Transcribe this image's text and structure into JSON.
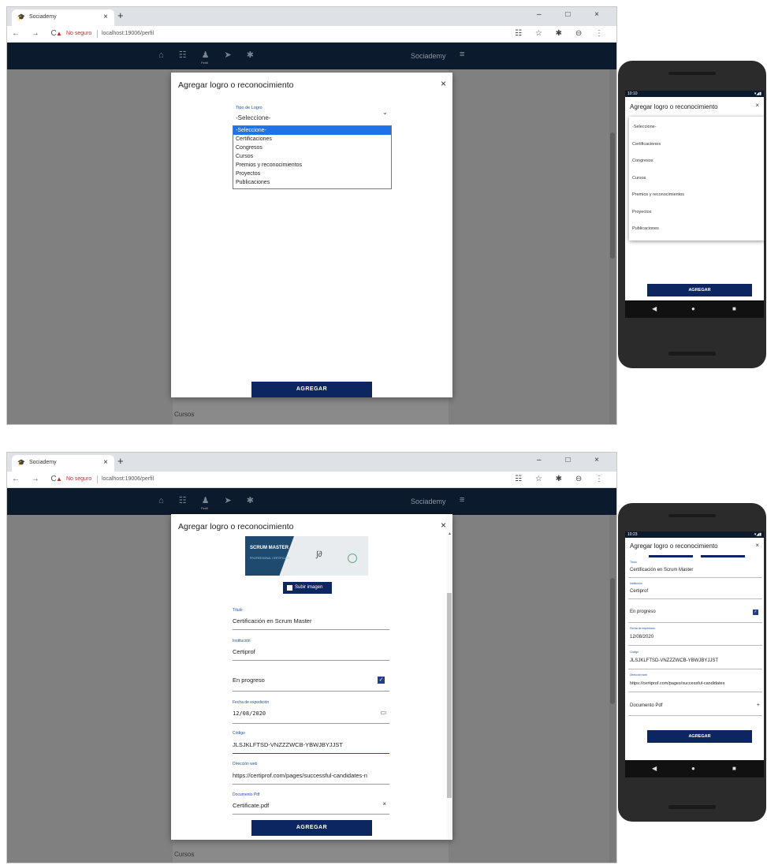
{
  "browser": {
    "tab_title": "Sociademy",
    "tab_close": "×",
    "new_tab": "+",
    "window_controls": "– □ ×",
    "nav_buttons": "← → C",
    "not_secure": "No seguro",
    "url": "localhost:19006/perfil",
    "extension_icons": "☷ ☆ ✱ ⊖ ⋮"
  },
  "app": {
    "brand": "Sociademy",
    "menu_icon": "≡",
    "nav_icons": "⌂ ☷ ♟ ➤ ✱",
    "nav_active_label": "Perfil",
    "background_section": "Cursos"
  },
  "modal": {
    "title": "Agregar logro o reconocimiento",
    "close": "×",
    "submit": "AGREGAR"
  },
  "top_panel": {
    "select_label": "Tipo de Logro",
    "select_value": "-Seleccione-",
    "select_arrow": "⌄",
    "options": [
      "-Seleccione-",
      "Certificaciones",
      "Congresos",
      "Cursos",
      "Premios y reconocimientos",
      "Proyectos",
      "Publicaciones"
    ],
    "phone_status_time": "10:10",
    "phone_status_icons": "▾◢▮",
    "phone_options": [
      "-Seleccione-",
      "Certificaciones",
      "Congresos",
      "Cursos",
      "Premios y reconocimientos",
      "Proyectos",
      "Publicaciones"
    ]
  },
  "bottom_panel": {
    "cert_title": "SCRUM MASTER",
    "cert_sub": "PROFESSIONAL CERTIFICATE",
    "upload_label": "Subir imagen",
    "fields": {
      "titulo_label": "Título",
      "titulo_value": "Certificación en Scrum Master",
      "institucion_label": "Institución",
      "institucion_value": "Certiprof",
      "progreso_label": "En progreso",
      "progreso_check": "✓",
      "fecha_label": "Fecha de expedición",
      "fecha_value": "12/08/2020",
      "fecha_icon": "▭",
      "codigo_label": "Código",
      "codigo_value": "JLSJKLFTSD-VNZZZWCB-YBWJBYJJST",
      "web_label": "Dirección web",
      "web_value": "https://certiprof.com/pages/successful-candidates-n",
      "pdf_label": "Documento Pdf",
      "pdf_value": "Certificate.pdf",
      "pdf_clear": "×"
    },
    "phone_status_time": "10:23",
    "phone_fields": {
      "fecha_value": "12/08/2020",
      "web_value": "https://certiprof.com/pages/successful-candidates",
      "pdf_label": "Documento Pdf",
      "pdf_add": "+"
    }
  },
  "phone_nav": {
    "back": "◀",
    "home": "●",
    "recents": "■"
  },
  "colors": {
    "appbar": "#0b1a2c",
    "primary_button": "#0b2660",
    "dropdown_selected": "#1e73e8",
    "label_blue": "#1e4fa0"
  }
}
